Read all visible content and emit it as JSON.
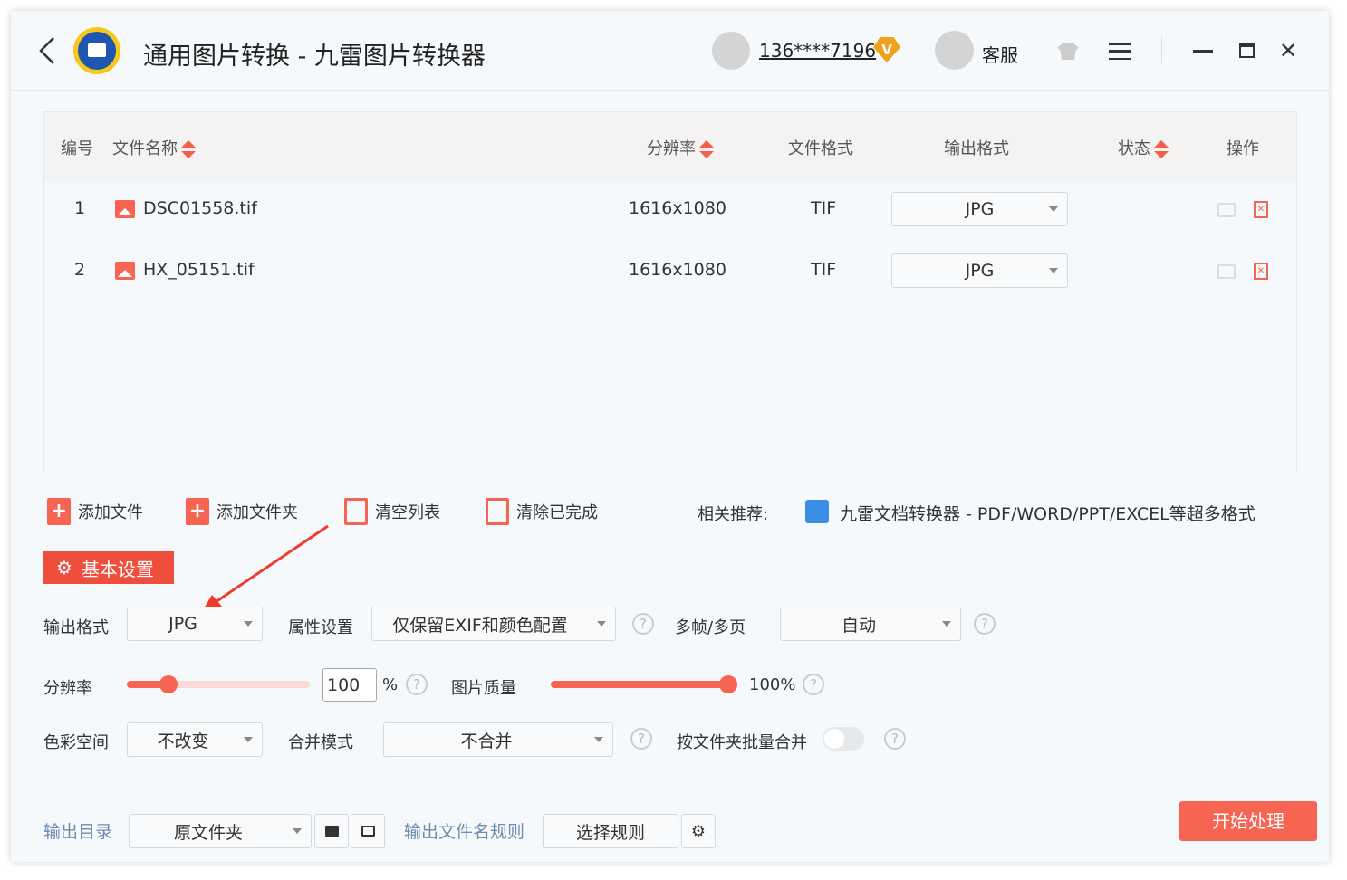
{
  "app": {
    "title": "通用图片转换 - 九雷图片转换器",
    "user": "136****7196",
    "vip_badge": "V",
    "support": "客服"
  },
  "table": {
    "headers": {
      "index": "编号",
      "filename": "文件名称",
      "resolution": "分辨率",
      "format": "文件格式",
      "output": "输出格式",
      "status": "状态",
      "action": "操作"
    },
    "rows": [
      {
        "index": "1",
        "filename": "DSC01558.tif",
        "resolution": "1616x1080",
        "format": "TIF",
        "output": "JPG"
      },
      {
        "index": "2",
        "filename": "HX_05151.tif",
        "resolution": "1616x1080",
        "format": "TIF",
        "output": "JPG"
      }
    ]
  },
  "toolbar": {
    "add_file": "添加文件",
    "add_folder": "添加文件夹",
    "clear_list": "清空列表",
    "clear_done": "清除已完成",
    "recommend_label": "相关推荐:",
    "recommend_link": "九雷文档转换器 - PDF/WORD/PPT/EXCEL等超多格式"
  },
  "settings": {
    "tab": "基本设置",
    "output_format_label": "输出格式",
    "output_format": "JPG",
    "attr_label": "属性设置",
    "attr": "仅保留EXIF和颜色配置",
    "multiframe_label": "多帧/多页",
    "multiframe": "自动",
    "resolution_label": "分辨率",
    "resolution_value": "100",
    "resolution_unit": "%",
    "resolution_slider_fraction": 0.23,
    "quality_label": "图片质量",
    "quality_value": "100%",
    "quality_fraction": 1.0,
    "colorspace_label": "色彩空间",
    "colorspace": "不改变",
    "merge_label": "合并模式",
    "merge": "不合并",
    "batch_merge_label": "按文件夹批量合并",
    "batch_merge_on": false
  },
  "footer": {
    "output_dir_label": "输出目录",
    "output_dir": "原文件夹",
    "name_rule_label": "输出文件名规则",
    "name_rule": "选择规则",
    "start": "开始处理"
  },
  "colors": {
    "accent": "#f76452",
    "tab": "#f04e3c",
    "link": "#6c8cb0"
  }
}
